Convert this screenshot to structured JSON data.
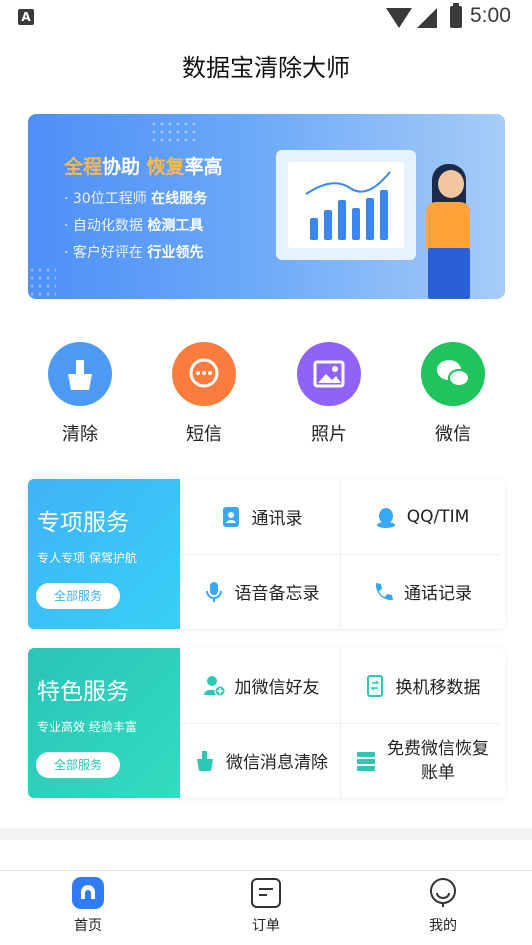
{
  "status_bar": {
    "time": "5:00",
    "notification_icon": "A"
  },
  "header": {
    "title": "数据宝清除大师"
  },
  "banner": {
    "headline_parts": [
      "全程",
      "协助 ",
      "恢复",
      "率高"
    ],
    "lines": [
      {
        "prefix": "· 30位工程师 ",
        "bold": "在线服务"
      },
      {
        "prefix": "· 自动化数据 ",
        "bold": "检测工具"
      },
      {
        "prefix": "· 客户好评在 ",
        "bold": "行业领先"
      }
    ]
  },
  "categories": [
    {
      "label": "清除",
      "icon": "broom-icon",
      "color": "#4d9af5"
    },
    {
      "label": "短信",
      "icon": "message-icon",
      "color": "#fb7c3c"
    },
    {
      "label": "照片",
      "icon": "photo-icon",
      "color": "#8e63f6"
    },
    {
      "label": "微信",
      "icon": "wechat-icon",
      "color": "#20c35e"
    }
  ],
  "special_service": {
    "title": "专项服务",
    "subtitle": "专人专项 保驾护航",
    "button": "全部服务",
    "gradient": [
      "#3fb2f7",
      "#38d0f6"
    ],
    "items": [
      {
        "label": "通讯录",
        "icon": "contacts-icon"
      },
      {
        "label": "QQ/TIM",
        "icon": "qq-icon"
      },
      {
        "label": "语音备忘录",
        "icon": "microphone-icon"
      },
      {
        "label": "通话记录",
        "icon": "phone-icon"
      }
    ]
  },
  "featured_service": {
    "title": "特色服务",
    "subtitle": "专业高效 经验丰富",
    "button": "全部服务",
    "gradient": [
      "#29c4b8",
      "#33dcbf"
    ],
    "items": [
      {
        "label": "加微信好友",
        "icon": "add-friend-icon"
      },
      {
        "label": "换机移数据",
        "icon": "phone-transfer-icon"
      },
      {
        "label": "微信消息清除",
        "icon": "broom-icon"
      },
      {
        "label": "免费微信恢复账单",
        "label_line1": "免费微信恢复",
        "label_line2": "账单",
        "icon": "database-icon"
      }
    ]
  },
  "tabbar": {
    "tabs": [
      {
        "label": "首页",
        "icon": "home-icon",
        "active": true
      },
      {
        "label": "订单",
        "icon": "order-icon",
        "active": false
      },
      {
        "label": "我的",
        "icon": "profile-icon",
        "active": false
      }
    ]
  },
  "colors": {
    "accent": "#2f7cf6",
    "banner_highlight": "#ffb84d"
  }
}
